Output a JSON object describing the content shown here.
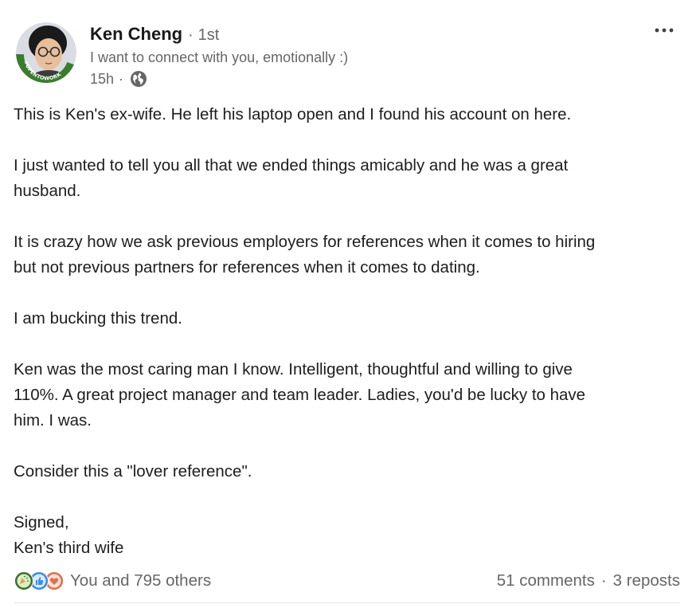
{
  "author": {
    "name": "Ken Cheng",
    "degree": "1st",
    "headline": "I want to connect with you, emotionally :)",
    "time": "15h",
    "avatar_badge": "#OPENTOWORK",
    "visibility_icon": "globe-icon"
  },
  "post": {
    "paragraphs": [
      [
        "This is Ken's ex-wife. He left his laptop open and I found his account on here."
      ],
      [
        "I just wanted to tell you all that we ended things amicably and he was a great",
        "husband."
      ],
      [
        "It is crazy how we ask previous employers for references when it comes to hiring",
        "but not previous partners for references when it comes to dating."
      ],
      [
        "I am bucking this trend."
      ],
      [
        "Ken was the most caring man I know. Intelligent, thoughtful and willing to give",
        "110%. A great project manager and team leader. Ladies, you'd be lucky to have",
        "him. I was."
      ],
      [
        "Consider this a \"lover reference\"."
      ],
      [
        "Signed,",
        "Ken's third wife"
      ]
    ]
  },
  "social": {
    "reactions_text": "You and 795 others",
    "reaction_icons": [
      "celebrate-icon",
      "like-icon",
      "love-icon"
    ],
    "comments": "51 comments",
    "separator": "·",
    "reposts": "3 reposts"
  },
  "menu_icon": "more-options-icon",
  "colors": {
    "open_to_work_green": "#3a7d2c",
    "like_blue": "#378fe9",
    "celebrate_green": "#44712e",
    "love_red": "#df704d",
    "muted_text": "#666666"
  }
}
